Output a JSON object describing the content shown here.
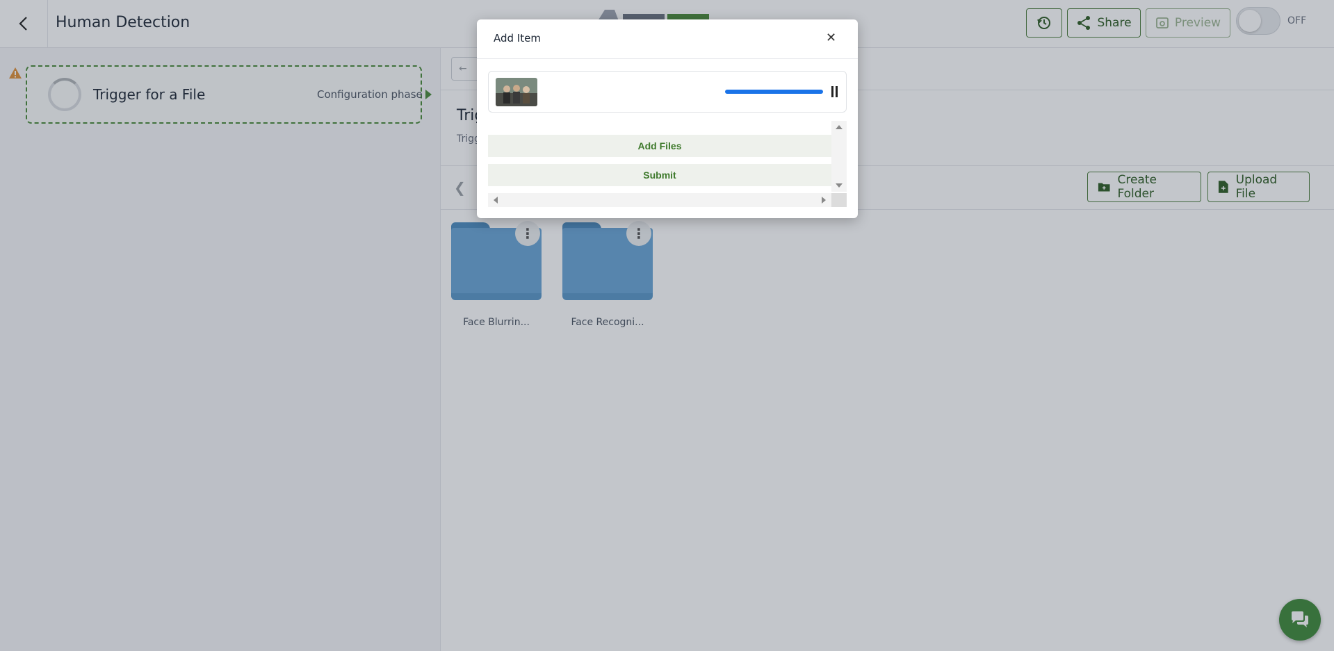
{
  "header": {
    "title": "Human Detection",
    "share_label": "Share",
    "preview_label": "Preview",
    "toggle_state": "OFF"
  },
  "workflow": {
    "trigger_title": "Trigger for a File",
    "phase": "Configuration phase"
  },
  "main": {
    "section_title": "Trig",
    "section_sub": "Trigg",
    "create_folder_label": "Create Folder",
    "upload_file_label": "Upload File",
    "folders": [
      {
        "name": "Face Blurrin..."
      },
      {
        "name": "Face Recogni..."
      }
    ]
  },
  "modal": {
    "title": "Add Item",
    "upload_progress": 1.0,
    "add_files_label": "Add Files",
    "submit_label": "Submit"
  },
  "colors": {
    "accent_green": "#4a7c3a",
    "progress_blue": "#1a73e8",
    "folder_blue": "#6aa6d6"
  }
}
